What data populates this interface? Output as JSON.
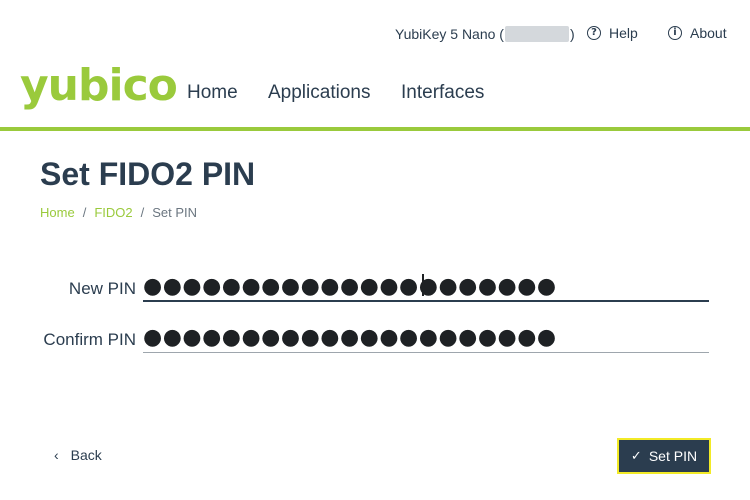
{
  "header": {
    "device_prefix": "YubiKey 5 Nano (",
    "device_suffix": ")",
    "help_label": "Help",
    "help_icon": "question-circle-icon",
    "about_label": "About",
    "about_icon": "info-circle-icon",
    "logo_text": "yubico",
    "nav": [
      {
        "label": "Home"
      },
      {
        "label": "Applications"
      },
      {
        "label": "Interfaces"
      }
    ],
    "accent_color": "#9aca3c"
  },
  "main": {
    "title": "Set FIDO2 PIN",
    "breadcrumb": [
      "Home",
      "FIDO2",
      "Set PIN"
    ],
    "new_pin": {
      "label": "New PIN",
      "value": "●●●●●●●●●●●●●●●●●●●●●"
    },
    "confirm_pin": {
      "label": "Confirm PIN",
      "value": "●●●●●●●●●●●●●●●●●●●●●"
    }
  },
  "footer": {
    "back_label": "Back",
    "back_icon": "chevron-left-icon",
    "set_pin_label": "Set PIN",
    "set_pin_icon": "check-icon"
  }
}
